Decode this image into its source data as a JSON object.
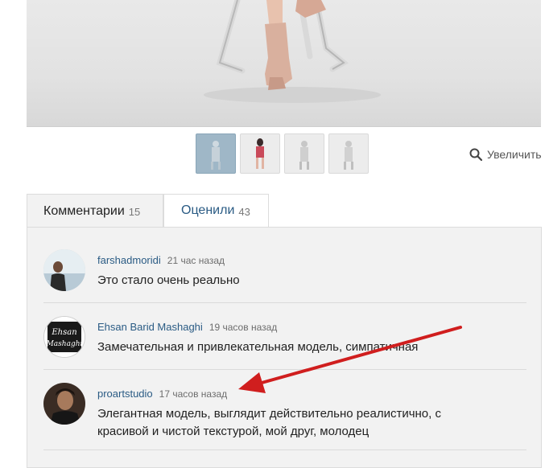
{
  "gallery": {
    "zoom_label": "Увеличить",
    "zoom_icon": "magnifier-icon",
    "thumbnail_count": 4,
    "active_thumbnail": 1
  },
  "tabs": [
    {
      "label": "Комментарии",
      "count": "15",
      "active": true
    },
    {
      "label": "Оценили",
      "count": "43",
      "active": false
    }
  ],
  "comments": [
    {
      "user": "farshadmoridi",
      "time": "21 час назад",
      "text": "Это стало очень реально"
    },
    {
      "user": "Ehsan Barid Mashaghi",
      "time": "19 часов назад",
      "text": "Замечательная и привлекательная модель, симпатичная",
      "avatar_text": [
        "Ehsan",
        "Mashaghi"
      ]
    },
    {
      "user": "proartstudio",
      "time": "17 часов назад",
      "text": "Элегантная модель, выглядит действительно реалистично, с красивой и чистой текстурой, мой друг, молодец"
    }
  ],
  "colors": {
    "link": "#2a5b84",
    "annotation_arrow": "#d01e1e",
    "panel_bg": "#f2f2f2"
  }
}
